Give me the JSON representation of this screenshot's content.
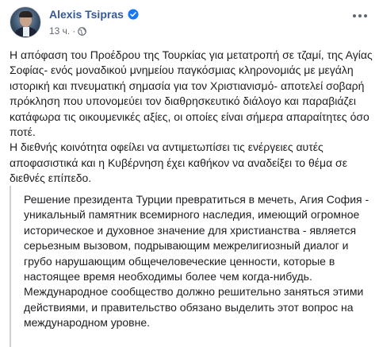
{
  "post": {
    "author": "Alexis Tsipras",
    "time": "13 ч.",
    "separator": "·",
    "greek_paragraphs": [
      "Η απόφαση του Προέδρου της Τουρκίας για μετατροπή σε τζαμί, της Αγίας Σοφίας- ενός μοναδικού μνημείου παγκόσμιας κληρονομιάς με μεγάλη ιστορική και πνευματική σημασία για τον Χριστιανισμό- αποτελεί σοβαρή πρόκληση που υπονομεύει τον διαθρησκευτικό διάλογο και παραβιάζει κατάφωρα τις οικουμενικές αξίες, οι οποίες είναι σήμερα απαραίτητες όσο ποτέ.",
      "Η διεθνής κοινότητα οφείλει να αντιμετωπίσει τις ενέργειες αυτές αποφασιστικά και η Κυβέρνηση έχει καθήκον να αναδείξει το θέμα σε διεθνές επίπεδο."
    ],
    "translation_paragraphs": [
      "Решение президента Турции превратиться в мечеть, Агия София - уникальный памятник всемирного наследия, имеющий огромное историческое и духовное значение для христианства - является серьезным вызовом, подрывающим межрелигиозный диалог и грубо нарушающим общечеловеческие ценности, которые в настоящее время необходимы более чем когда-нибудь.",
      "Международное сообщество должно решительно заняться этими действиями, и правительство обязано выделить этот вопрос на международном уровне."
    ]
  },
  "icons": {
    "verified": "verified-badge-icon",
    "audience": "globe-icon",
    "more": "more-options-icon"
  },
  "colors": {
    "author_link": "#385898",
    "verified": "#1877f2",
    "meta_text": "#606770",
    "body_text": "#1c1e21",
    "quote_border": "#ccd0d5"
  }
}
